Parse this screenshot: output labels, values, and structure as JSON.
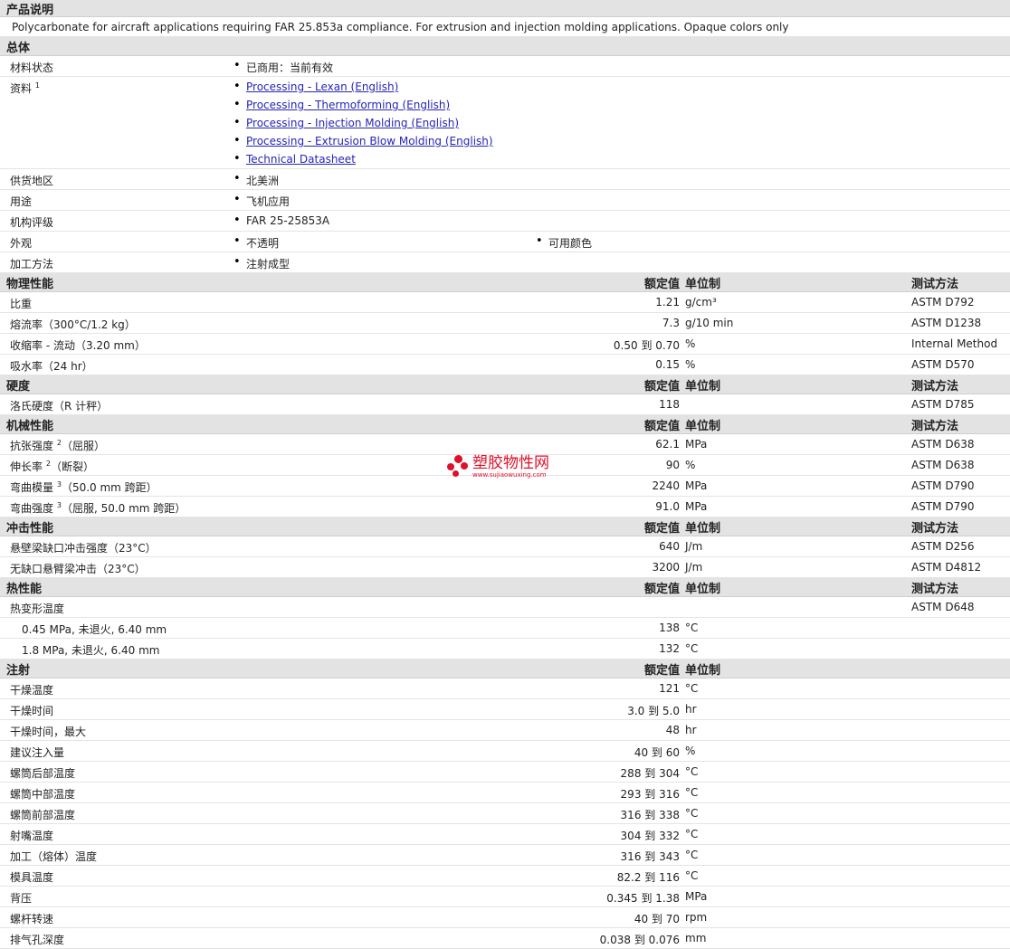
{
  "sections": {
    "description": {
      "title": "产品说明",
      "text": "Polycarbonate for aircraft applications requiring FAR 25.853a compliance. For extrusion and injection molding applications. Opaque colors only"
    },
    "general": {
      "title": "总体",
      "status": {
        "label": "材料状态",
        "value": "已商用：当前有效"
      },
      "docs": {
        "label": "资料",
        "sup": "1",
        "links": [
          "Processing - Lexan (English)",
          "Processing - Thermoforming (English)",
          "Processing - Injection Molding (English)",
          "Processing - Extrusion Blow Molding (English)",
          "Technical Datasheet"
        ]
      },
      "region": {
        "label": "供货地区",
        "value": "北美洲"
      },
      "use": {
        "label": "用途",
        "value": "飞机应用"
      },
      "rating": {
        "label": "机构评级",
        "value": "FAR 25-25853A"
      },
      "appearance": {
        "label": "外观",
        "value": "不透明",
        "value2": "可用颜色"
      },
      "process": {
        "label": "加工方法",
        "value": "注射成型"
      }
    },
    "physical": {
      "title": "物理性能",
      "rows": [
        {
          "label": "比重",
          "nominal": "1.21",
          "unit": "g/cm³",
          "method": "ASTM D792"
        },
        {
          "label": "熔流率（300°C/1.2 kg）",
          "nominal": "7.3",
          "unit": "g/10 min",
          "method": "ASTM D1238"
        },
        {
          "label": "收缩率 - 流动（3.20 mm）",
          "nominal": "0.50 到  0.70",
          "unit": "%",
          "method": "Internal Method"
        },
        {
          "label": "吸水率（24 hr）",
          "nominal": "0.15",
          "unit": "%",
          "method": "ASTM D570"
        }
      ]
    },
    "hardness": {
      "title": "硬度",
      "rows": [
        {
          "label": "洛氏硬度（R 计秤）",
          "nominal": "118",
          "unit": "",
          "method": "ASTM D785"
        }
      ]
    },
    "mechanical": {
      "title": "机械性能",
      "rows": [
        {
          "label": "抗张强度",
          "sup": "2",
          "suffix": "（屈服）",
          "nominal": "62.1",
          "unit": "MPa",
          "method": "ASTM D638"
        },
        {
          "label": "伸长率",
          "sup": "2",
          "suffix": "（断裂）",
          "nominal": "90",
          "unit": "%",
          "method": "ASTM D638"
        },
        {
          "label": "弯曲模量",
          "sup": "3",
          "suffix": "（50.0 mm 跨距）",
          "nominal": "2240",
          "unit": "MPa",
          "method": "ASTM D790"
        },
        {
          "label": "弯曲强度",
          "sup": "3",
          "suffix": "（屈服, 50.0 mm 跨距）",
          "nominal": "91.0",
          "unit": "MPa",
          "method": "ASTM D790"
        }
      ]
    },
    "impact": {
      "title": "冲击性能",
      "rows": [
        {
          "label": "悬壁梁缺口冲击强度（23°C）",
          "nominal": "640",
          "unit": "J/m",
          "method": "ASTM D256"
        },
        {
          "label": "无缺口悬臂梁冲击（23°C）",
          "nominal": "3200",
          "unit": "J/m",
          "method": "ASTM D4812"
        }
      ]
    },
    "thermal": {
      "title": "热性能",
      "rows": [
        {
          "label": "热变形温度",
          "nominal": "",
          "unit": "",
          "method": "ASTM D648"
        },
        {
          "label": "0.45 MPa, 未退火, 6.40 mm",
          "nominal": "138",
          "unit": "°C",
          "method": "",
          "sub": true
        },
        {
          "label": "1.8 MPa, 未退火, 6.40 mm",
          "nominal": "132",
          "unit": "°C",
          "method": "",
          "sub": true
        }
      ]
    },
    "injection": {
      "title": "注射",
      "rows": [
        {
          "label": "干燥温度",
          "nominal": "121",
          "unit": "°C"
        },
        {
          "label": "干燥时间",
          "nominal": "3.0 到  5.0",
          "unit": "hr"
        },
        {
          "label": "干燥时间，最大",
          "nominal": "48",
          "unit": "hr"
        },
        {
          "label": "建议注入量",
          "nominal": "40 到  60",
          "unit": "%"
        },
        {
          "label": "螺筒后部温度",
          "nominal": "288 到  304",
          "unit": "°C"
        },
        {
          "label": "螺筒中部温度",
          "nominal": "293 到  316",
          "unit": "°C"
        },
        {
          "label": "螺筒前部温度",
          "nominal": "316 到  338",
          "unit": "°C"
        },
        {
          "label": "射嘴温度",
          "nominal": "304 到  332",
          "unit": "°C"
        },
        {
          "label": "加工（熔体）温度",
          "nominal": "316 到  343",
          "unit": "°C"
        },
        {
          "label": "模具温度",
          "nominal": "82.2 到  116",
          "unit": "°C"
        },
        {
          "label": "背压",
          "nominal": "0.345 到  1.38",
          "unit": "MPa"
        },
        {
          "label": "螺杆转速",
          "nominal": "40 到  70",
          "unit": "rpm"
        },
        {
          "label": "排气孔深度",
          "nominal": "0.038 到  0.076",
          "unit": "mm"
        }
      ]
    }
  },
  "headers": {
    "nominal": "额定值",
    "unit": "单位制",
    "method": "测试方法"
  },
  "watermark": {
    "text": "塑胶物性网",
    "url": "www.sujiaowuxing.com"
  }
}
